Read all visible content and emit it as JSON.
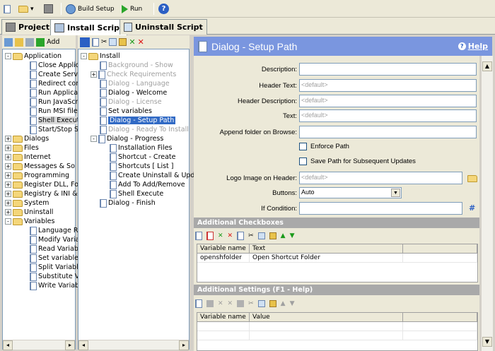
{
  "toolbar": {
    "build": "Build Setup",
    "run": "Run"
  },
  "tabs": [
    {
      "label": "Project"
    },
    {
      "label": "Install Script"
    },
    {
      "label": "Uninstall Script"
    }
  ],
  "left": {
    "add": "Add",
    "items": [
      {
        "label": "Application",
        "level": 0,
        "type": "folder",
        "exp": "-"
      },
      {
        "label": "Close Applic",
        "level": 1,
        "type": "doc"
      },
      {
        "label": "Create Servic",
        "level": 1,
        "type": "doc"
      },
      {
        "label": "Redirect con",
        "level": 1,
        "type": "doc"
      },
      {
        "label": "Run Applicat",
        "level": 1,
        "type": "doc"
      },
      {
        "label": "Run JavaScr",
        "level": 1,
        "type": "doc"
      },
      {
        "label": "Run MSI file",
        "level": 1,
        "type": "doc"
      },
      {
        "label": "Shell Execute",
        "level": 1,
        "type": "doc",
        "hl": true
      },
      {
        "label": "Start/Stop Se",
        "level": 1,
        "type": "doc"
      },
      {
        "label": "Dialogs",
        "level": 0,
        "type": "folder",
        "exp": "+"
      },
      {
        "label": "Files",
        "level": 0,
        "type": "folder",
        "exp": "+"
      },
      {
        "label": "Internet",
        "level": 0,
        "type": "folder",
        "exp": "+"
      },
      {
        "label": "Messages & So",
        "level": 0,
        "type": "folder",
        "exp": "+"
      },
      {
        "label": "Programming",
        "level": 0,
        "type": "folder",
        "exp": "+"
      },
      {
        "label": "Register DLL, Fo",
        "level": 0,
        "type": "folder",
        "exp": "+"
      },
      {
        "label": "Registry & INI &",
        "level": 0,
        "type": "folder",
        "exp": "+"
      },
      {
        "label": "System",
        "level": 0,
        "type": "folder",
        "exp": "+"
      },
      {
        "label": "Uninstall",
        "level": 0,
        "type": "folder",
        "exp": "+"
      },
      {
        "label": "Variables",
        "level": 0,
        "type": "folder",
        "exp": "-"
      },
      {
        "label": "Language Re",
        "level": 1,
        "type": "doc"
      },
      {
        "label": "Modify Varial",
        "level": 1,
        "type": "doc"
      },
      {
        "label": "Read Variab",
        "level": 1,
        "type": "doc"
      },
      {
        "label": "Set variables",
        "level": 1,
        "type": "doc"
      },
      {
        "label": "Split Variable",
        "level": 1,
        "type": "doc"
      },
      {
        "label": "Substitute Va",
        "level": 1,
        "type": "doc"
      },
      {
        "label": "Write Variabl",
        "level": 1,
        "type": "doc"
      }
    ]
  },
  "middle": {
    "items": [
      {
        "label": "Install",
        "level": 0,
        "type": "folder",
        "exp": "-"
      },
      {
        "label": "Background - Show",
        "level": 1,
        "type": "doc",
        "gray": true
      },
      {
        "label": "Check Requirements",
        "level": 1,
        "type": "doc",
        "gray": true,
        "exp": "+"
      },
      {
        "label": "Dialog - Language",
        "level": 1,
        "type": "doc",
        "gray": true
      },
      {
        "label": "Dialog - Welcome",
        "level": 1,
        "type": "doc"
      },
      {
        "label": "Dialog - License",
        "level": 1,
        "type": "doc",
        "gray": true
      },
      {
        "label": "Set variables",
        "level": 1,
        "type": "doc"
      },
      {
        "label": "Dialog - Setup Path",
        "level": 1,
        "type": "doc",
        "sel": true
      },
      {
        "label": "Dialog - Ready To Install",
        "level": 1,
        "type": "doc",
        "gray": true
      },
      {
        "label": "Dialog - Progress",
        "level": 1,
        "type": "doc",
        "exp": "-"
      },
      {
        "label": "Installation Files",
        "level": 2,
        "type": "doc"
      },
      {
        "label": "Shortcut - Create",
        "level": 2,
        "type": "doc"
      },
      {
        "label": "Shortcuts [ List ]",
        "level": 2,
        "type": "doc"
      },
      {
        "label": "Create Uninstall & Upd",
        "level": 2,
        "type": "doc"
      },
      {
        "label": "Add To Add/Remove",
        "level": 2,
        "type": "doc"
      },
      {
        "label": "Shell Execute",
        "level": 2,
        "type": "doc"
      },
      {
        "label": "Dialog - Finish",
        "level": 1,
        "type": "doc"
      }
    ]
  },
  "header": {
    "title": "Dialog - Setup Path",
    "help": "Help"
  },
  "form": {
    "description_label": "Description:",
    "description_value": "",
    "header_text_label": "Header Text:",
    "header_text_value": "<default>",
    "header_desc_label": "Header Description:",
    "header_desc_value": "<default>",
    "text_label": "Text:",
    "text_value": "<default>",
    "append_label": "Append folder on Browse:",
    "append_value": "",
    "enforce_path": "Enforce Path",
    "save_path": "Save Path for Subsequent Updates",
    "logo_label": "Logo Image on Header:",
    "logo_value": "<default>",
    "buttons_label": "Buttons:",
    "buttons_value": "Auto",
    "if_label": "If Condition:",
    "if_value": "",
    "hash": "#"
  },
  "checkboxes": {
    "title": "Additional Checkboxes",
    "col1": "Variable name",
    "col2": "Text",
    "rows": [
      {
        "var": "openshfolder",
        "text": "Open Shortcut Folder"
      }
    ]
  },
  "settings": {
    "title": "Additional Settings (F1 - Help)",
    "col1": "Variable name",
    "col2": "Value"
  }
}
